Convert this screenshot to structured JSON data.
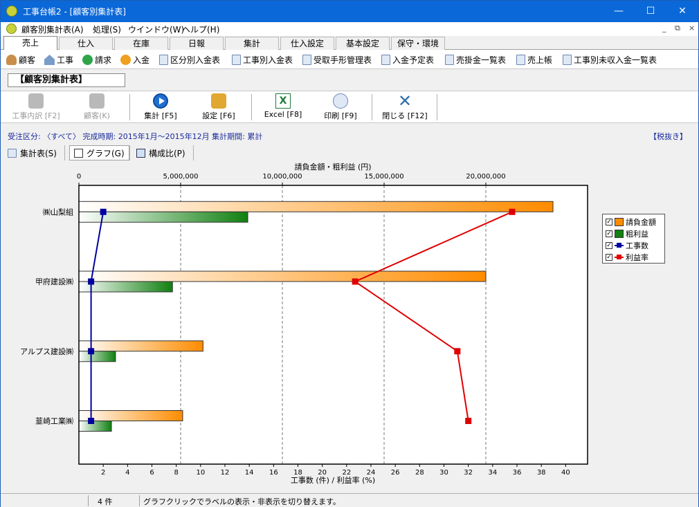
{
  "window": {
    "title": "工事台帳2 - [顧客別集計表]",
    "minimize": "—",
    "maximize": "☐",
    "close": "✕"
  },
  "menu": {
    "items": [
      "顧客別集計表(A)",
      "処理(S)",
      "ウインドウ(W)",
      "ヘルプ(H)"
    ],
    "mdi": [
      "_",
      "⧉",
      "×"
    ]
  },
  "main_tabs": {
    "items": [
      "売上",
      "仕入",
      "在庫",
      "日報",
      "集計",
      "仕入設定",
      "基本設定",
      "保守・環境"
    ],
    "active": "売上"
  },
  "quickbar": {
    "items": [
      {
        "label": "顧客",
        "icon": "customer-icon"
      },
      {
        "label": "工事",
        "icon": "construction-icon"
      },
      {
        "label": "請求",
        "icon": "billing-icon"
      },
      {
        "label": "入金",
        "icon": "payment-icon"
      },
      {
        "label": "区分別入金表",
        "icon": "document-icon"
      },
      {
        "label": "工事別入金表",
        "icon": "document-icon"
      },
      {
        "label": "受取手形管理表",
        "icon": "document-icon"
      },
      {
        "label": "入金予定表",
        "icon": "document-icon"
      },
      {
        "label": "売掛金一覧表",
        "icon": "document-icon"
      },
      {
        "label": "売上帳",
        "icon": "document-icon"
      },
      {
        "label": "工事別未収入金一覧表",
        "icon": "document-icon"
      }
    ]
  },
  "section_title": "【顧客別集計表】",
  "toolbar": {
    "buttons": [
      {
        "label": "工事内訳 [F2]",
        "icon": "detail-icon",
        "enabled": false
      },
      {
        "label": "顧客(K)",
        "icon": "customer-icon",
        "enabled": false
      },
      {
        "label": "集計 [F5]",
        "icon": "run-icon",
        "enabled": true
      },
      {
        "label": "設定 [F6]",
        "icon": "settings-icon",
        "enabled": true
      },
      {
        "label": "Excel [F8]",
        "icon": "excel-icon",
        "enabled": true
      },
      {
        "label": "印刷 [F9]",
        "icon": "print-icon",
        "enabled": true
      },
      {
        "label": "閉じる [F12]",
        "icon": "close-icon",
        "enabled": true
      }
    ]
  },
  "info": {
    "line": "受注区分: 〈すべて〉 完成時期: 2015年1月～2015年12月 集計期間: 累計",
    "tax": "【税抜き】"
  },
  "view_tabs": {
    "items": [
      "集計表(S)",
      "グラフ(G)",
      "構成比(P)"
    ],
    "active": "グラフ(G)"
  },
  "colors": {
    "billing": "#ff8c00",
    "profit": "#108010",
    "count": "#0000a0",
    "rate": "#e00000"
  },
  "chart_data": {
    "type": "bar",
    "categories": [
      "㈱山梨組",
      "甲府建設㈱",
      "アルプス建設㈱",
      "韮崎工業㈱"
    ],
    "series": [
      {
        "name": "請負金額",
        "axis": "top",
        "values": [
          23300000,
          20000000,
          6100000,
          5100000
        ]
      },
      {
        "name": "粗利益",
        "axis": "top",
        "values": [
          8300000,
          4600000,
          1800000,
          1600000
        ]
      },
      {
        "name": "工事数",
        "axis": "bottom",
        "type": "line",
        "values": [
          2,
          1,
          1,
          1
        ]
      },
      {
        "name": "利益率",
        "axis": "bottom",
        "type": "line",
        "values": [
          35.6,
          22.7,
          31.1,
          32.0
        ]
      }
    ],
    "top_axis": {
      "label": "請負金額・粗利益 (円)",
      "range": [
        0,
        25000000
      ],
      "ticks": [
        "0",
        "5,000,000",
        "10,000,000",
        "15,000,000",
        "20,000,000"
      ]
    },
    "bottom_axis": {
      "label": "工事数 (件) / 利益率 (%)",
      "range": [
        0,
        41.8
      ],
      "ticks": [
        "2",
        "4",
        "6",
        "8",
        "10",
        "12",
        "14",
        "16",
        "18",
        "20",
        "22",
        "24",
        "26",
        "28",
        "30",
        "32",
        "34",
        "36",
        "38",
        "40"
      ]
    },
    "grid": "vertical dashed"
  },
  "status": {
    "count": "4 件",
    "message": "グラフクリックでラベルの表示・非表示を切り替えます。"
  }
}
